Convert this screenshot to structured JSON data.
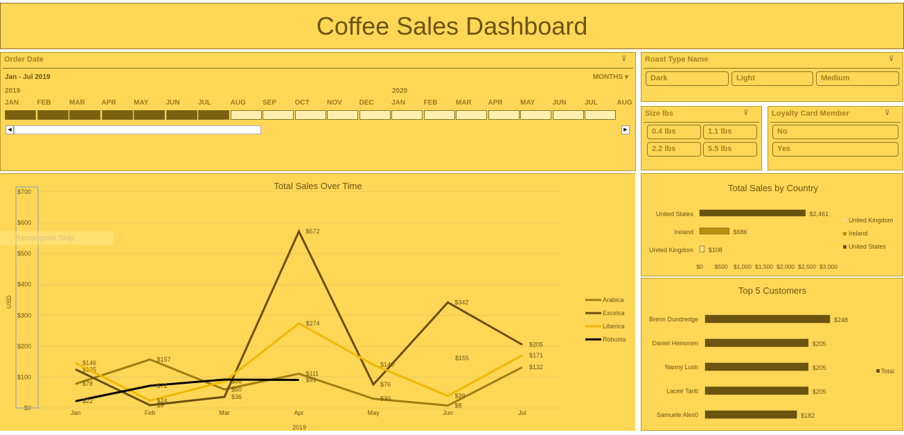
{
  "title": "Coffee Sales Dashboard",
  "order_date": {
    "header": "Order Date",
    "range": "Jan - Jul 2019",
    "period": "MONTHS",
    "year1": "2019",
    "year2": "2020",
    "months": [
      "JAN",
      "FEB",
      "MAR",
      "APR",
      "MAY",
      "JUN",
      "JUL",
      "AUG",
      "SEP",
      "OCT",
      "NOV",
      "DEC",
      "JAN",
      "FEB",
      "MAR",
      "APR",
      "MAY",
      "JUN",
      "JUL",
      "AUG"
    ],
    "selected": [
      true,
      true,
      true,
      true,
      true,
      true,
      true,
      false,
      false,
      false,
      false,
      false,
      false,
      false,
      false,
      false,
      false,
      false,
      false,
      false
    ]
  },
  "roast": {
    "header": "Roast Type Name",
    "items": [
      "Dark",
      "Light",
      "Medium"
    ]
  },
  "size": {
    "header": "Size lbs",
    "items": [
      "0.4 lbs",
      "1.1 lbs",
      "2.2 lbs",
      "5.5 lbs"
    ]
  },
  "loyalty": {
    "header": "Loyalty Card Member",
    "items": [
      "No",
      "Yes"
    ]
  },
  "ghost_text": "Rectangular Snip",
  "chart_data": [
    {
      "type": "line",
      "title": "Total Sales Over Time",
      "xlabel": "2019",
      "ylabel": "USD",
      "categories": [
        "Jan",
        "Feb",
        "Mar",
        "Apr",
        "May",
        "Jun",
        "Jul"
      ],
      "ylim": [
        0,
        700
      ],
      "yticks": [
        "$0",
        "$100",
        "$200",
        "$300",
        "$400",
        "$500",
        "$600",
        "$700"
      ],
      "grid": true,
      "legend_position": "right",
      "series": [
        {
          "name": "Arabica",
          "color": "#a07d12",
          "values": [
            78,
            157,
            60,
            111,
            30,
            8,
            132
          ],
          "labels": [
            "$78",
            "$157",
            "$60",
            "$111",
            "$30",
            "$8",
            "$132"
          ]
        },
        {
          "name": "Excelsa",
          "color": "#6b4e10",
          "values": [
            125,
            9,
            36,
            572,
            76,
            342,
            205
          ],
          "labels": [
            "$125",
            "$9",
            "$36",
            "$572",
            "$76",
            "$342",
            "$205"
          ]
        },
        {
          "name": "Liberica",
          "color": "#f0b800",
          "values": [
            146,
            24,
            86,
            274,
            140,
            39,
            171
          ],
          "labels": [
            "$146",
            "$24",
            "$86",
            "$274",
            "$140",
            "$39",
            "$171"
          ]
        },
        {
          "name": "Robusta",
          "color": "#000000",
          "values": [
            22,
            72,
            92,
            91,
            null,
            null,
            null
          ],
          "labels": [
            "$22",
            "$72",
            "",
            "$91",
            "",
            "",
            ""
          ]
        }
      ],
      "extra_label": "$155"
    },
    {
      "type": "bar",
      "orientation": "horizontal",
      "title": "Total Sales by Country",
      "categories": [
        "United States",
        "Ireland",
        "United Kingdom"
      ],
      "values": [
        2461,
        686,
        108
      ],
      "labels": [
        "$2,461",
        "$686",
        "$108"
      ],
      "colors": [
        "#6b5410",
        "#b8900e",
        "#f3dc8a"
      ],
      "xticks": [
        "$0",
        "$500",
        "$1,000",
        "$1,500",
        "$2,000",
        "$2,500",
        "$3,000"
      ],
      "xlim": [
        0,
        3000
      ],
      "legend": [
        "United Kingdom",
        "Ireland",
        "United States"
      ],
      "legend_position": "right"
    },
    {
      "type": "bar",
      "orientation": "horizontal",
      "title": "Top 5  Customers",
      "categories": [
        "Brenn Dundredge",
        "Daniel Heinonen",
        "Nanny Lush",
        "Lacee Tanti",
        "Samuele Ales0"
      ],
      "values": [
        248,
        205,
        205,
        205,
        182
      ],
      "labels": [
        "$248",
        "$205",
        "$205",
        "$205",
        "$182"
      ],
      "color": "#6b5410",
      "legend": [
        "Total"
      ],
      "legend_position": "right"
    }
  ]
}
